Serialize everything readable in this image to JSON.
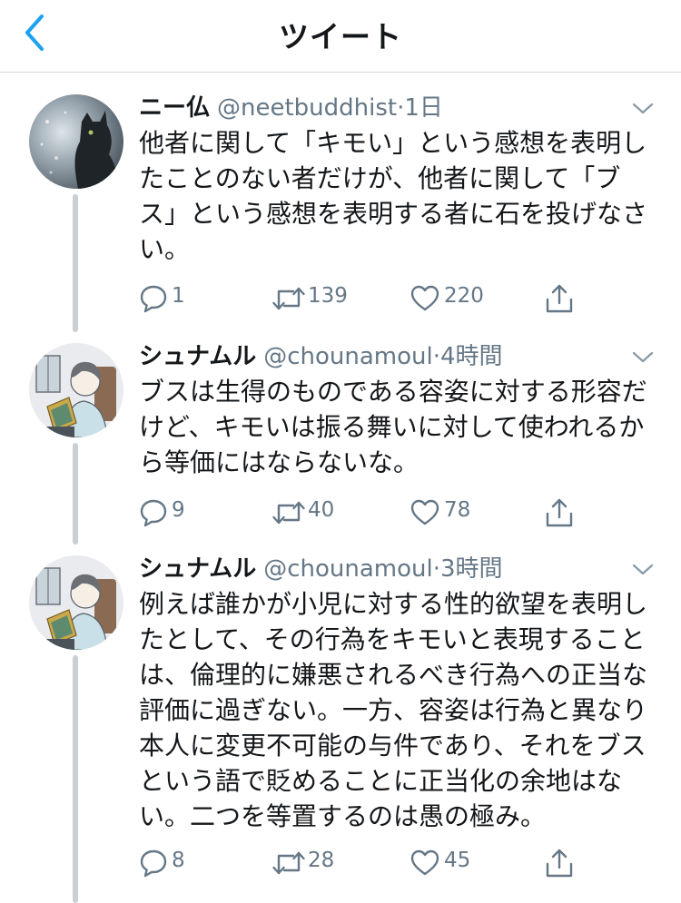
{
  "header": {
    "title": "ツイート",
    "back_icon": "chevron-left-icon"
  },
  "colors": {
    "accent": "#1da1f2",
    "text": "#14171a",
    "secondary": "#657786",
    "thread_line": "#c8d0d6",
    "divider": "#d3d6da"
  },
  "tweets": [
    {
      "display_name": "ニー仏",
      "handle": "@neetbuddhist",
      "separator": "·",
      "time": "1日",
      "text_lines": [
        "他者に関して「キモい」という感想を表明し",
        "たことのない者だけが、他者に関して「ブ",
        "ス」という感想を表明する者に石を投げなさ",
        "い。"
      ],
      "replies": "1",
      "retweets": "139",
      "likes": "220"
    },
    {
      "display_name": "シュナムル",
      "handle": "@chounamoul",
      "separator": "·",
      "time": "4時間",
      "text_lines": [
        "ブスは生得のものである容姿に対する形容だ",
        "けど、キモいは振る舞いに対して使われるか",
        "ら等価にはならないな。"
      ],
      "replies": "9",
      "retweets": "40",
      "likes": "78"
    },
    {
      "display_name": "シュナムル",
      "handle": "@chounamoul",
      "separator": "·",
      "time": "3時間",
      "text_lines": [
        "例えば誰かが小児に対する性的欲望を表明し",
        "たとして、その行為をキモいと表現すること",
        "は、倫理的に嫌悪されるべき行為への正当な",
        "評価に過ぎない。一方、容姿は行為と異なり",
        "本人に変更不可能の与件であり、それをブス",
        "という語で貶めることに正当化の余地はな",
        "い。二つを等置するのは愚の極み。"
      ],
      "replies": "8",
      "retweets": "28",
      "likes": "45"
    }
  ]
}
